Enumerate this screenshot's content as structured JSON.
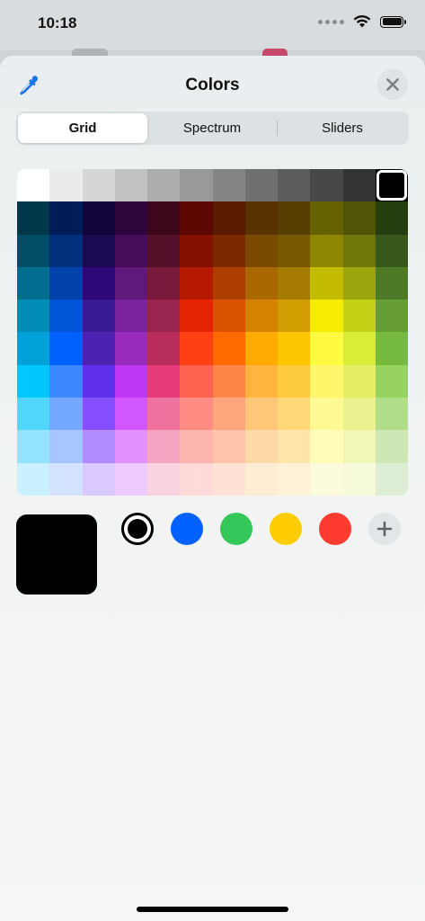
{
  "status_bar": {
    "time": "10:18"
  },
  "header": {
    "title": "Colors",
    "eyedropper_icon": "eyedropper-icon",
    "close_icon": "xmark-icon"
  },
  "tabs": [
    {
      "label": "Grid",
      "active": true
    },
    {
      "label": "Spectrum",
      "active": false
    },
    {
      "label": "Sliders",
      "active": false
    }
  ],
  "grid": {
    "selected": {
      "row": 0,
      "col": 11
    },
    "rows": [
      [
        "#ffffff",
        "#ebebeb",
        "#d6d6d6",
        "#c2c2c2",
        "#adadad",
        "#999999",
        "#858585",
        "#707070",
        "#5c5c5c",
        "#474747",
        "#333333",
        "#000000"
      ],
      [
        "#00374a",
        "#011d57",
        "#11053b",
        "#2e063d",
        "#3c071b",
        "#5c0701",
        "#5a1c00",
        "#583300",
        "#563d00",
        "#666100",
        "#4f5504",
        "#263e0f"
      ],
      [
        "#004d65",
        "#012f7b",
        "#1a0a52",
        "#450d59",
        "#551029",
        "#831100",
        "#7b2900",
        "#7a4a00",
        "#785800",
        "#8c8602",
        "#6f760a",
        "#38571a"
      ],
      [
        "#016e8f",
        "#0042a9",
        "#2c0977",
        "#61187c",
        "#791a3d",
        "#b51a00",
        "#ad3e00",
        "#a96800",
        "#a67b01",
        "#c4bc00",
        "#9ba50e",
        "#4e7a27"
      ],
      [
        "#008cb4",
        "#0056d6",
        "#371a94",
        "#7a219e",
        "#99244f",
        "#e22400",
        "#da5100",
        "#d38301",
        "#d19d01",
        "#f5ec00",
        "#c3d117",
        "#669d34"
      ],
      [
        "#00a1d8",
        "#0061fe",
        "#4d22b2",
        "#982abc",
        "#b92d5d",
        "#ff4015",
        "#ff6a00",
        "#ffab01",
        "#fcc700",
        "#fefb41",
        "#d9ec37",
        "#76bb40"
      ],
      [
        "#01c7fc",
        "#3a87fe",
        "#5e30eb",
        "#be38f3",
        "#e63b7a",
        "#fe6250",
        "#fe8648",
        "#feb43f",
        "#fecb3e",
        "#fff76b",
        "#e4ef65",
        "#96d35f"
      ],
      [
        "#52d6fc",
        "#74a7ff",
        "#864ffe",
        "#d357fe",
        "#ee719e",
        "#ff8c82",
        "#fea57d",
        "#fec777",
        "#fed977",
        "#fff994",
        "#eaf28f",
        "#b1dd8b"
      ],
      [
        "#93e3fc",
        "#a7c6ff",
        "#b18cfe",
        "#e292fe",
        "#f4a4c0",
        "#ffb5af",
        "#ffc5ab",
        "#fed9a8",
        "#fde4a8",
        "#fffbb9",
        "#f1f7b7",
        "#cde8b5"
      ],
      [
        "#cbf0ff",
        "#d3e2ff",
        "#d9c9fe",
        "#efcaff",
        "#f9d3e0",
        "#ffdad8",
        "#ffe2d6",
        "#feecd4",
        "#fef1d5",
        "#fdfbdd",
        "#f6fadb",
        "#deeed4"
      ]
    ]
  },
  "current_color": "#000000",
  "favorites": [
    {
      "color": "#000000",
      "selected": true
    },
    {
      "color": "#0061fe",
      "selected": false
    },
    {
      "color": "#34c759",
      "selected": false
    },
    {
      "color": "#ffcc00",
      "selected": false
    },
    {
      "color": "#ff3b30",
      "selected": false
    }
  ],
  "add_icon": "plus-icon"
}
